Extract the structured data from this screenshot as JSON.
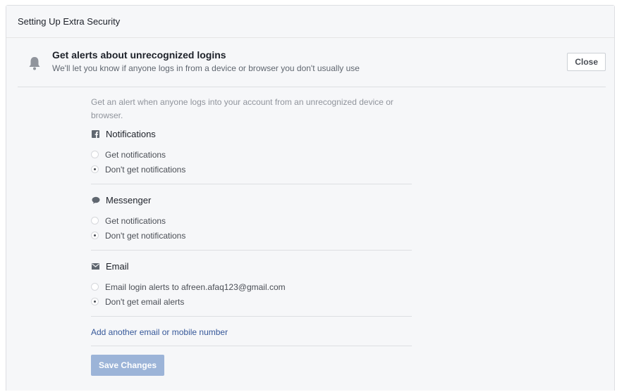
{
  "panel": {
    "title": "Setting Up Extra Security"
  },
  "section": {
    "title": "Get alerts about unrecognized logins",
    "subtitle": "We'll let you know if anyone logs in from a device or browser you don't usually use",
    "close_label": "Close",
    "icon": "bell-icon"
  },
  "intro": "Get an alert when anyone logs into your account from an unrecognized device or browser.",
  "groups": [
    {
      "title": "Notifications",
      "icon": "facebook-icon",
      "options": [
        {
          "label": "Get notifications",
          "checked": false
        },
        {
          "label": "Don't get notifications",
          "checked": true
        }
      ]
    },
    {
      "title": "Messenger",
      "icon": "chat-bubble-icon",
      "options": [
        {
          "label": "Get notifications",
          "checked": false
        },
        {
          "label": "Don't get notifications",
          "checked": true
        }
      ]
    },
    {
      "title": "Email",
      "icon": "envelope-icon",
      "options": [
        {
          "label": "Email login alerts to afreen.afaq123@gmail.com",
          "checked": false
        },
        {
          "label": "Don't get email alerts",
          "checked": true
        }
      ]
    }
  ],
  "add_contact_label": "Add another email or mobile number",
  "save_label": "Save Changes",
  "colors": {
    "link": "#365899",
    "save_disabled": "#9cb4d8",
    "panel_bg": "#f6f7f9"
  }
}
